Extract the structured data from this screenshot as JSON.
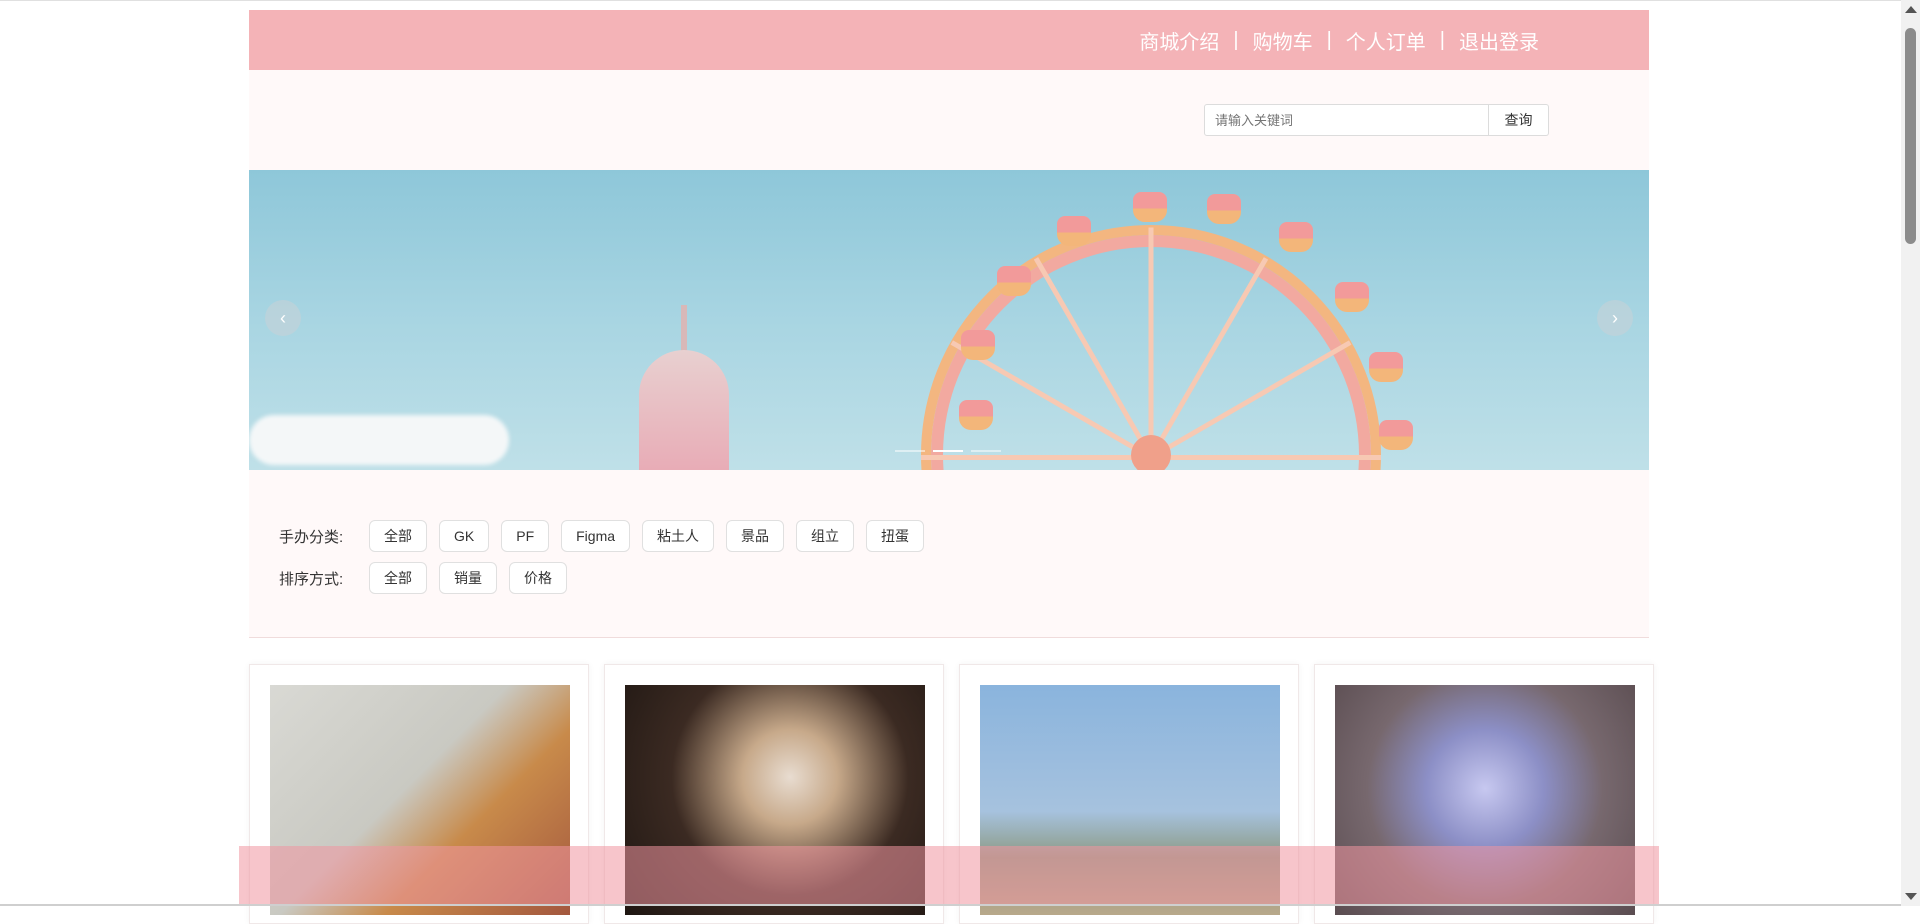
{
  "nav": {
    "items": [
      {
        "label": "商城介绍"
      },
      {
        "label": "购物车"
      },
      {
        "label": "个人订单"
      },
      {
        "label": "退出登录"
      }
    ],
    "separator": "|",
    "bg_color": "#f4b3b7"
  },
  "search": {
    "placeholder": "请输入关键词",
    "value": "",
    "button_label": "查询"
  },
  "carousel": {
    "prev_icon": "‹",
    "next_icon": "›",
    "slide_count": 3,
    "active_index": 1
  },
  "filters": {
    "category_label": "手办分类:",
    "categories": [
      "全部",
      "GK",
      "PF",
      "Figma",
      "粘土人",
      "景品",
      "组立",
      "扭蛋"
    ],
    "sort_label": "排序方式:",
    "sorts": [
      "全部",
      "销量",
      "价格"
    ]
  },
  "products": [
    {
      "image": "figure-photo-1"
    },
    {
      "image": "figure-photo-2"
    },
    {
      "image": "figure-photo-3"
    },
    {
      "image": "figure-photo-4"
    }
  ],
  "colors": {
    "accent": "#f4b3b7",
    "band": "#fff9f9"
  }
}
